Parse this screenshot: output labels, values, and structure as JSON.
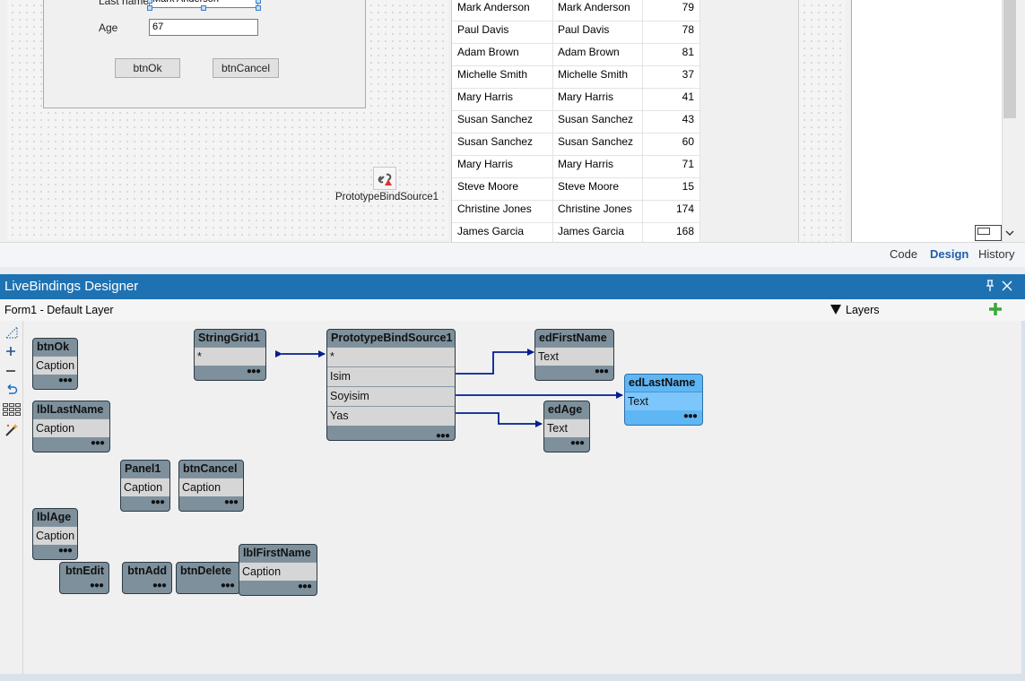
{
  "form": {
    "last_name_label": "Last name",
    "last_name_value": "Mark Anderson",
    "age_label": "Age",
    "age_value": "67",
    "ok_label": "btnOk",
    "cancel_label": "btnCancel",
    "bind_source_label": "PrototypeBindSource1"
  },
  "grid_rows": [
    [
      "Mark Anderson",
      "Mark Anderson",
      "79"
    ],
    [
      "Paul Davis",
      "Paul Davis",
      "78"
    ],
    [
      "Adam Brown",
      "Adam Brown",
      "81"
    ],
    [
      "Michelle Smith",
      "Michelle Smith",
      "37"
    ],
    [
      "Mary Harris",
      "Mary Harris",
      "41"
    ],
    [
      "Susan Sanchez",
      "Susan Sanchez",
      "43"
    ],
    [
      "Susan Sanchez",
      "Susan Sanchez",
      "60"
    ],
    [
      "Mary Harris",
      "Mary Harris",
      "71"
    ],
    [
      "Steve Moore",
      "Steve Moore",
      "15"
    ],
    [
      "Christine Jones",
      "Christine Jones",
      "174"
    ],
    [
      "James Garcia",
      "James Garcia",
      "168"
    ]
  ],
  "view_tabs": [
    "Code",
    "Design",
    "History"
  ],
  "active_tab": "Design",
  "livebindings": {
    "title": "LiveBindings Designer",
    "form_label": "Form1  - Default Layer",
    "layers_label": "Layers"
  },
  "nodes": {
    "btnOk": {
      "name": "btnOk",
      "member": "Caption"
    },
    "lblLastName": {
      "name": "lblLastName",
      "member": "Caption"
    },
    "stringGrid1": {
      "name": "StringGrid1",
      "member": "*"
    },
    "bindSource": {
      "name": "PrototypeBindSource1",
      "members": [
        "*",
        "Isim",
        "Soyisim",
        "Yas"
      ]
    },
    "edFirstName": {
      "name": "edFirstName",
      "member": "Text"
    },
    "edLastName": {
      "name": "edLastName",
      "member": "Text"
    },
    "edAge": {
      "name": "edAge",
      "member": "Text"
    },
    "panel1": {
      "name": "Panel1",
      "member": "Caption"
    },
    "btnCancel": {
      "name": "btnCancel",
      "member": "Caption"
    },
    "lblAge": {
      "name": "lblAge",
      "member": "Caption"
    },
    "btnEdit": {
      "name": "btnEdit"
    },
    "btnAdd": {
      "name": "btnAdd"
    },
    "btnDelete": {
      "name": "btnDelete"
    },
    "lblFirstName": {
      "name": "lblFirstName",
      "member": "Caption"
    }
  },
  "colors": {
    "title_bar": "#1f72b2",
    "node_body": "#7d909c",
    "node_selected": "#5fb6f5",
    "link": "#001f8f"
  }
}
